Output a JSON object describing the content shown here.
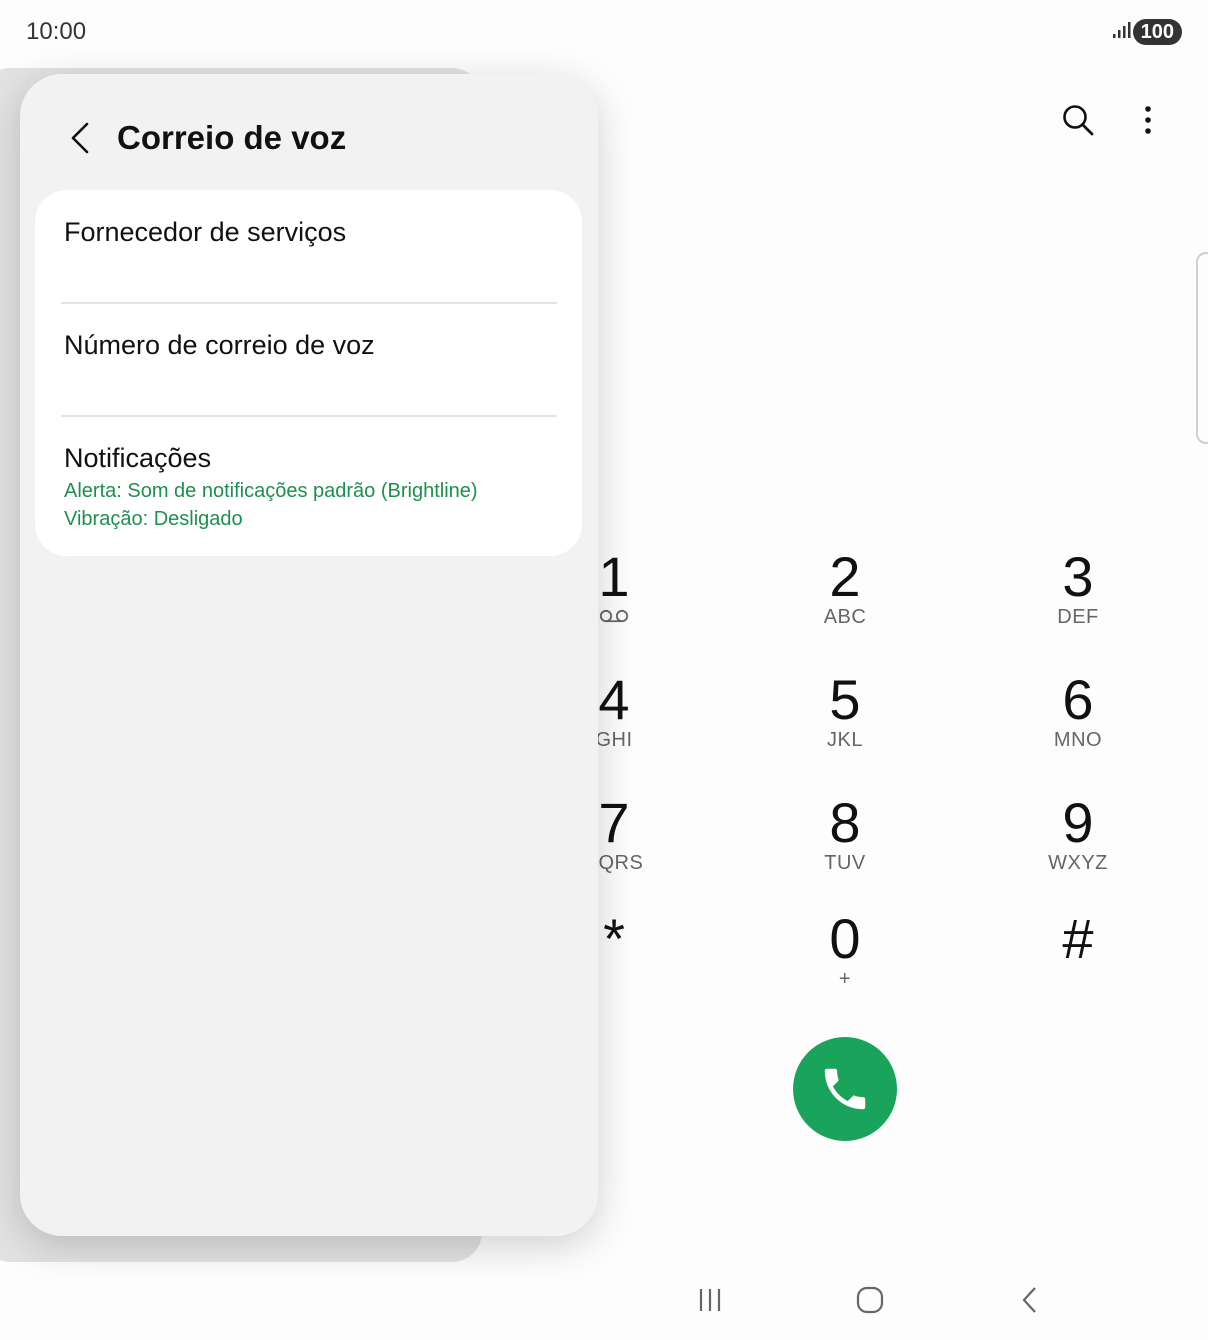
{
  "status": {
    "time": "10:00",
    "battery": "100"
  },
  "popup": {
    "title": "Correio de voz",
    "rows": [
      {
        "title": "Fornecedor de serviços"
      },
      {
        "title": "Número de correio de voz"
      },
      {
        "title": "Notificações",
        "sub1": "Alerta: Som de notificações padrão (Brightline)",
        "sub2": "Vibração: Desligado"
      }
    ]
  },
  "keypad": {
    "keys": [
      {
        "digit": "1",
        "letters": ""
      },
      {
        "digit": "2",
        "letters": "ABC"
      },
      {
        "digit": "3",
        "letters": "DEF"
      },
      {
        "digit": "4",
        "letters": "GHI"
      },
      {
        "digit": "5",
        "letters": "JKL"
      },
      {
        "digit": "6",
        "letters": "MNO"
      },
      {
        "digit": "7",
        "letters": "PQRS"
      },
      {
        "digit": "8",
        "letters": "TUV"
      },
      {
        "digit": "9",
        "letters": "WXYZ"
      },
      {
        "digit": "*",
        "letters": ""
      },
      {
        "digit": "0",
        "letters": "+"
      },
      {
        "digit": "#",
        "letters": ""
      }
    ]
  },
  "colors": {
    "accent_green": "#1aa35a",
    "subtitle_green": "#1e8f4e"
  }
}
